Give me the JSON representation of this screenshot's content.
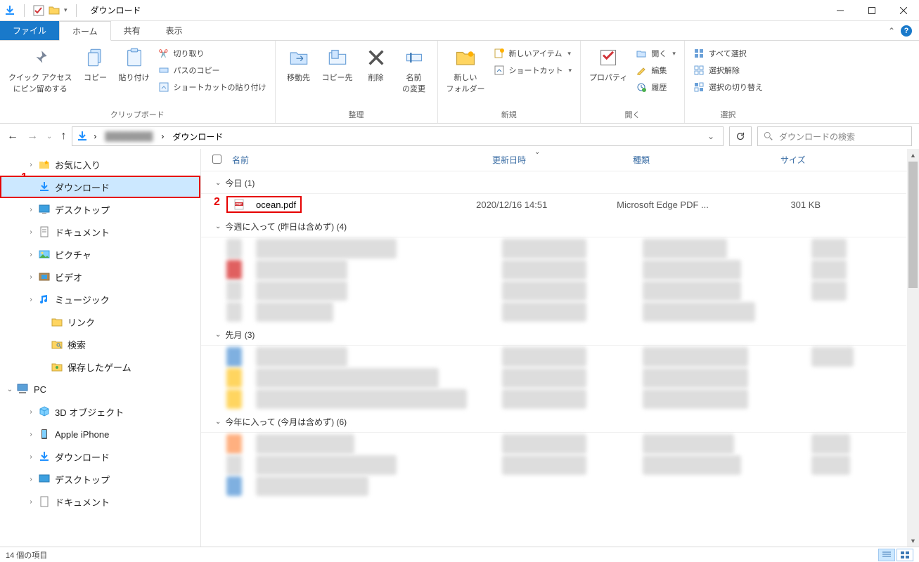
{
  "window": {
    "title": "ダウンロード"
  },
  "tabs": {
    "file": "ファイル",
    "home": "ホーム",
    "share": "共有",
    "view": "表示"
  },
  "ribbon": {
    "clipboard": {
      "pin": "クイック アクセス\nにピン留めする",
      "copy": "コピー",
      "paste": "貼り付け",
      "cut": "切り取り",
      "copypath": "パスのコピー",
      "pasteshortcut": "ショートカットの貼り付け",
      "label": "クリップボード"
    },
    "organize": {
      "moveto": "移動先",
      "copyto": "コピー先",
      "delete": "削除",
      "rename": "名前\nの変更",
      "label": "整理"
    },
    "new": {
      "newfolder": "新しい\nフォルダー",
      "newitem": "新しいアイテム",
      "shortcut": "ショートカット",
      "label": "新規"
    },
    "open": {
      "properties": "プロパティ",
      "open": "開く",
      "edit": "編集",
      "history": "履歴",
      "label": "開く"
    },
    "select": {
      "selectall": "すべて選択",
      "selectnone": "選択解除",
      "invert": "選択の切り替え",
      "label": "選択"
    }
  },
  "breadcrumb": {
    "current": "ダウンロード"
  },
  "search": {
    "placeholder": "ダウンロードの検索"
  },
  "tree": {
    "favorites": "お気に入り",
    "downloads": "ダウンロード",
    "desktop": "デスクトップ",
    "documents": "ドキュメント",
    "pictures": "ピクチャ",
    "videos": "ビデオ",
    "music": "ミュージック",
    "links": "リンク",
    "searches": "検索",
    "savedgames": "保存したゲーム",
    "pc": "PC",
    "objects3d": "3D オブジェクト",
    "iphone": "Apple iPhone",
    "downloads2": "ダウンロード",
    "desktop2": "デスクトップ",
    "documents2": "ドキュメント"
  },
  "columns": {
    "name": "名前",
    "date": "更新日時",
    "type": "種類",
    "size": "サイズ"
  },
  "groups": {
    "today": "今日 (1)",
    "thisweek": "今週に入って (昨日は含めず) (4)",
    "lastmonth": "先月 (3)",
    "thisyear": "今年に入って (今月は含めず) (6)"
  },
  "file1": {
    "name": "ocean.pdf",
    "date": "2020/12/16 14:51",
    "type": "Microsoft Edge PDF ...",
    "size": "301 KB"
  },
  "annotations": {
    "one": "1",
    "two": "2"
  },
  "status": {
    "count": "14 個の項目"
  }
}
